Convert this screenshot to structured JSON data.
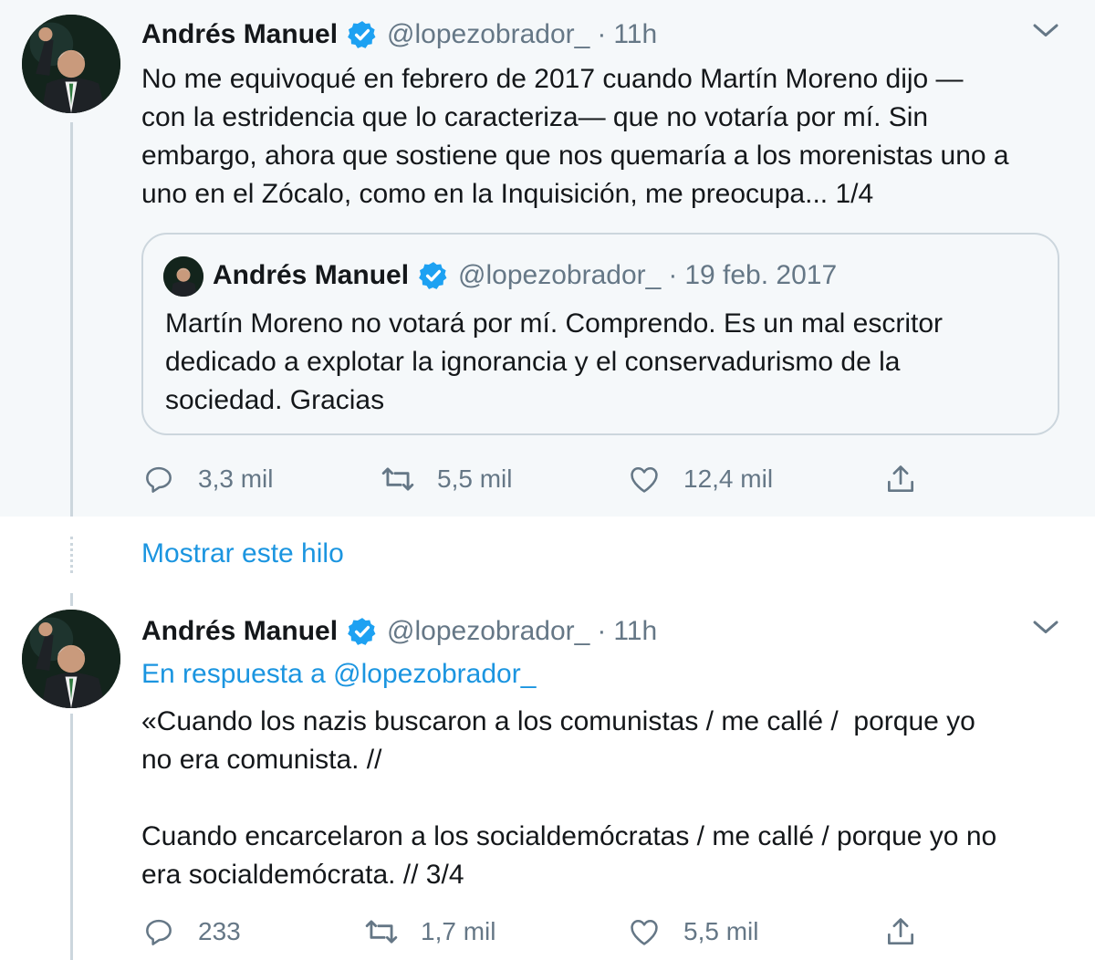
{
  "tweets": [
    {
      "author_name": "Andrés Manuel",
      "handle": "@lopezobrador_",
      "separator": "·",
      "time": "11h",
      "text": "No me equivoqué en febrero de 2017 cuando Martín Moreno dijo —\ncon la estridencia que lo caracteriza— que no votaría por mí. Sin\nembargo, ahora que sostiene que nos quemaría a los morenistas uno a\nuno en el Zócalo, como en la Inquisición, me preocupa... 1/4",
      "quoted": {
        "author_name": "Andrés Manuel",
        "handle": "@lopezobrador_",
        "separator": "·",
        "time": "19 feb. 2017",
        "text": "Martín Moreno no votará por mí. Comprendo. Es un mal escritor\ndedicado a explotar la ignorancia y el conservadurismo de la\nsociedad. Gracias"
      },
      "reply_count": "3,3 mil",
      "retweet_count": "5,5 mil",
      "like_count": "12,4 mil"
    },
    {
      "author_name": "Andrés Manuel",
      "handle": "@lopezobrador_",
      "separator": "·",
      "time": "11h",
      "reply_prefix": "En respuesta a ",
      "reply_handle": "@lopezobrador_",
      "text": "«Cuando los nazis buscaron a los comunistas / me callé /  porque yo\nno era comunista. //\n\nCuando encarcelaron a los socialdemócratas / me callé / porque yo no\nera socialdemócrata. // 3/4",
      "reply_count": "233",
      "retweet_count": "1,7 mil",
      "like_count": "5,5 mil"
    }
  ],
  "show_thread_label": "Mostrar este hilo",
  "colors": {
    "accent": "#1b95e0",
    "verified": "#1da1f2",
    "muted": "#657786",
    "text": "#14171a",
    "highlight_bg": "#f5f8fa",
    "border": "#ccd6dd"
  },
  "icons": [
    "verified-badge-icon",
    "chevron-down-icon",
    "reply-icon",
    "retweet-icon",
    "like-icon",
    "share-icon"
  ]
}
